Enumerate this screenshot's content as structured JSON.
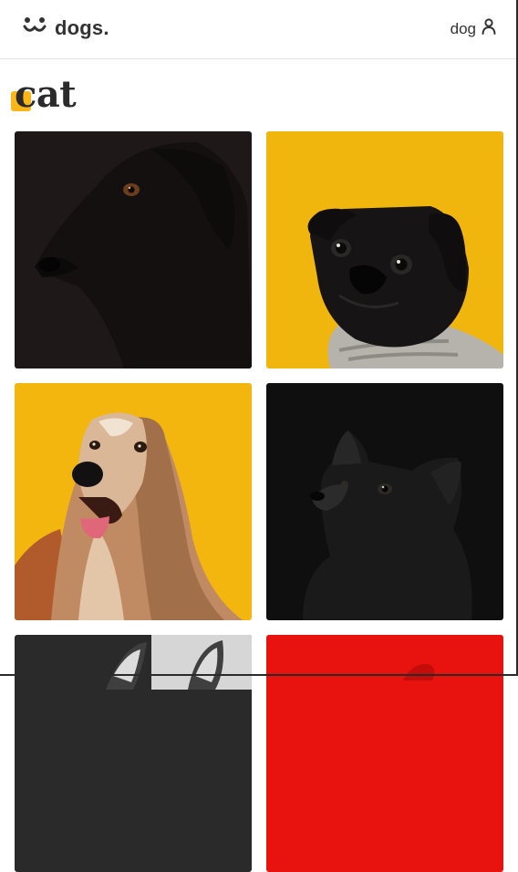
{
  "header": {
    "logo_text": "dogs.",
    "logo_icon": "dog-face-icon",
    "user_label": "dog",
    "user_icon": "user-icon"
  },
  "page": {
    "title": "cat",
    "accent_color": "#fbb717"
  },
  "photos": [
    {
      "subject": "black-dog-profile",
      "bg": "#1f1819"
    },
    {
      "subject": "black-pug-sweater",
      "bg": "#f0b60e"
    },
    {
      "subject": "afghan-hound",
      "bg": "#f3b60f"
    },
    {
      "subject": "black-dog-looking-up",
      "bg": "#0f0f0f"
    },
    {
      "subject": "dog-ears-grey",
      "bg": "#2a2a2a"
    },
    {
      "subject": "red-background",
      "bg": "#e8130f"
    }
  ]
}
